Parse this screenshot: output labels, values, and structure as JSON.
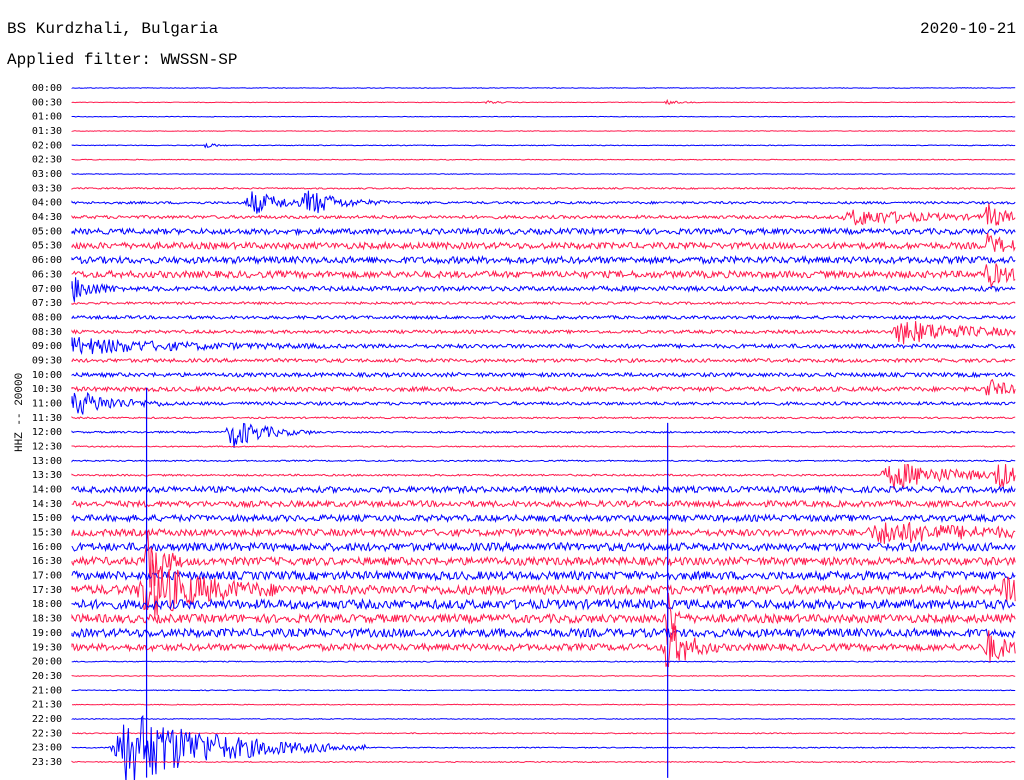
{
  "header": {
    "station": "BS Kurdzhali, Bulgaria",
    "filter": "Applied filter: WWSSN-SP",
    "date": "2020-10-21"
  },
  "colors": {
    "blue": "#0000ff",
    "red": "#ff1a4d",
    "text": "#000000"
  },
  "chart_data": {
    "type": "line",
    "title": "BS Kurdzhali, Bulgaria",
    "subtitle": "Applied filter: WWSSN-SP",
    "ylabel": "HHZ -- 20000",
    "date": "2020-10-21",
    "row_labels": [
      "00:00",
      "00:30",
      "01:00",
      "01:30",
      "02:00",
      "02:30",
      "03:00",
      "03:30",
      "04:00",
      "04:30",
      "05:00",
      "05:30",
      "06:00",
      "06:30",
      "07:00",
      "07:30",
      "08:00",
      "08:30",
      "09:00",
      "09:30",
      "10:00",
      "10:30",
      "11:00",
      "11:30",
      "12:00",
      "12:30",
      "13:00",
      "13:30",
      "14:00",
      "14:30",
      "15:00",
      "15:30",
      "16:00",
      "16:30",
      "17:00",
      "17:30",
      "18:00",
      "18:30",
      "19:00",
      "19:30",
      "20:00",
      "20:30",
      "21:00",
      "21:30",
      "22:00",
      "22:30",
      "23:00",
      "23:30"
    ],
    "row_colors_cycle": [
      "blue",
      "red"
    ],
    "noise_level": [
      0.3,
      0.3,
      0.3,
      0.3,
      0.4,
      0.4,
      0.3,
      0.7,
      1.2,
      1.6,
      2.8,
      3.2,
      3.4,
      3.4,
      2.4,
      1.2,
      1.6,
      1.6,
      2.0,
      1.8,
      2.0,
      2.2,
      1.6,
      0.8,
      0.9,
      0.6,
      0.7,
      0.9,
      3.0,
      3.0,
      3.2,
      3.4,
      4.0,
      4.0,
      4.2,
      4.6,
      4.6,
      4.2,
      4.2,
      3.4,
      0.5,
      0.4,
      0.4,
      0.4,
      0.4,
      0.5,
      0.5,
      0.5
    ],
    "events": [
      {
        "row": 1,
        "x": 0.44,
        "amp": 1.5,
        "dur": 0.02
      },
      {
        "row": 1,
        "x": 0.63,
        "amp": 2.0,
        "dur": 0.02
      },
      {
        "row": 4,
        "x": 0.14,
        "amp": 3.0,
        "dur": 0.015
      },
      {
        "row": 8,
        "x": 0.19,
        "amp": 12,
        "dur": 0.05
      },
      {
        "row": 8,
        "x": 0.25,
        "amp": 12,
        "dur": 0.05
      },
      {
        "row": 9,
        "x": 0.83,
        "amp": 8,
        "dur": 0.1
      },
      {
        "row": 9,
        "x": 0.97,
        "amp": 12,
        "dur": 0.03
      },
      {
        "row": 11,
        "x": 0.97,
        "amp": 10,
        "dur": 0.03
      },
      {
        "row": 13,
        "x": 0.97,
        "amp": 12,
        "dur": 0.03
      },
      {
        "row": 14,
        "x": 0.0,
        "amp": 14,
        "dur": 0.03
      },
      {
        "row": 17,
        "x": 0.88,
        "amp": 12,
        "dur": 0.1
      },
      {
        "row": 18,
        "x": 0.0,
        "amp": 8,
        "dur": 0.15
      },
      {
        "row": 21,
        "x": 0.97,
        "amp": 10,
        "dur": 0.03
      },
      {
        "row": 22,
        "x": 0.0,
        "amp": 14,
        "dur": 0.06
      },
      {
        "row": 24,
        "x": 0.17,
        "amp": 16,
        "dur": 0.05
      },
      {
        "row": 27,
        "x": 0.87,
        "amp": 14,
        "dur": 0.1
      },
      {
        "row": 27,
        "x": 0.98,
        "amp": 14,
        "dur": 0.03
      },
      {
        "row": 31,
        "x": 0.86,
        "amp": 10,
        "dur": 0.14
      },
      {
        "row": 33,
        "x": 0.08,
        "amp": 40,
        "dur": 0.02
      },
      {
        "row": 35,
        "x": 0.08,
        "amp": 30,
        "dur": 0.08
      },
      {
        "row": 35,
        "x": 0.99,
        "amp": 18,
        "dur": 0.05
      },
      {
        "row": 37,
        "x": 0.63,
        "amp": 40,
        "dur": 0.01
      },
      {
        "row": 39,
        "x": 0.63,
        "amp": 30,
        "dur": 0.03
      },
      {
        "row": 39,
        "x": 0.97,
        "amp": 16,
        "dur": 0.03
      },
      {
        "row": 46,
        "x": 0.06,
        "amp": 40,
        "dur": 0.14
      }
    ],
    "spikes": [
      {
        "row": 46,
        "x": 0.079,
        "amp_up": 360,
        "amp_down": 30
      },
      {
        "row": 38,
        "x": 0.631,
        "amp_up": 210,
        "amp_down": 145
      }
    ]
  }
}
